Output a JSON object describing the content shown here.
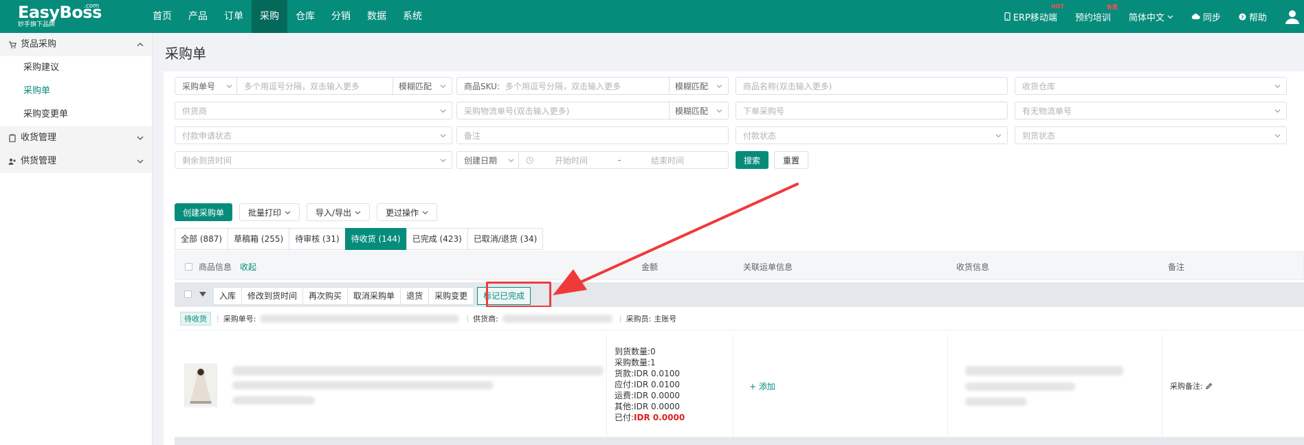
{
  "app": {
    "logo": "EasyBoss",
    "logo_com": ".com",
    "logo_sub": "妙手旗下品牌"
  },
  "nav": [
    "首页",
    "产品",
    "订单",
    "采购",
    "仓库",
    "分销",
    "数据",
    "系统"
  ],
  "topright": {
    "mobile": "ERP移动端",
    "mobile_badge": "HOT",
    "training": "预约培训",
    "training_badge": "免费",
    "language": "简体中文",
    "sync": "同步",
    "help": "帮助"
  },
  "sidebar": {
    "group1": "货品采购",
    "items": [
      "采购建议",
      "采购单",
      "采购变更单"
    ],
    "group2": "收货管理",
    "group3": "供货管理"
  },
  "page_title": "采购单",
  "filters": {
    "po_no_label": "采购单号",
    "po_no_ph": "多个用逗号分隔，双击输入更多",
    "match1": "模糊匹配",
    "sku_label": "商品SKU:",
    "sku_ph": "多个用逗号分隔，双击输入更多",
    "match2": "模糊匹配",
    "product_name_ph": "商品名称(双击输入更多)",
    "warehouse_ph": "收货仓库",
    "supplier_ph": "供货商",
    "logistics_ph": "采购物流单号(双击输入更多)",
    "match3": "模糊匹配",
    "order_no_ph": "下单采购号",
    "has_logistics_ph": "有无物流单号",
    "pay_apply_ph": "付款申请状态",
    "note_ph": "备注",
    "pay_status_ph": "付款状态",
    "arrival_status_ph": "到货状态",
    "remain_time_ph": "剩余到货时间",
    "date_type": "创建日期",
    "start_ph": "开始时间",
    "dash": "-",
    "end_ph": "结束时间",
    "search": "搜索",
    "reset": "重置"
  },
  "toolbar": {
    "create": "创建采购单",
    "print": "批量打印",
    "import_export": "导入/导出",
    "more": "更过操作"
  },
  "tabs": [
    {
      "label": "全部 (887)",
      "active": false
    },
    {
      "label": "草稿箱 (255)",
      "active": false
    },
    {
      "label": "待审核 (31)",
      "active": false
    },
    {
      "label": "待收货 (144)",
      "active": true
    },
    {
      "label": "已完成 (423)",
      "active": false
    },
    {
      "label": "已取消/退货 (34)",
      "active": false
    }
  ],
  "table": {
    "col_product": "商品信息",
    "collapse": "收起",
    "col_amount": "金额",
    "col_logistics": "关联运单信息",
    "col_receive": "收货信息",
    "col_note": "备注"
  },
  "actions": [
    "入库",
    "修改到货时间",
    "再次购买",
    "取消采购单",
    "退货",
    "采购变更",
    "标记已完成"
  ],
  "order": {
    "status": "待收货",
    "po_label": "采购单号:",
    "supplier_label": "供货商:",
    "buyer_label": "采购员:",
    "buyer": "主账号",
    "arrived_label": "到货数量:",
    "arrived": "0",
    "qty_label": "采购数量:",
    "qty": "1",
    "goods_label": "货款:",
    "goods": "IDR 0.0100",
    "payable_label": "应付:",
    "payable": "IDR 0.0100",
    "freight_label": "运费:",
    "freight": "IDR 0.0000",
    "other_label": "其他:",
    "other": "IDR 0.0000",
    "paid_label": "已付:",
    "paid": "IDR 0.0000",
    "add": "添加",
    "remark_label": "采购备注:"
  },
  "colors": {
    "brand": "#068c7b",
    "annotation": "#f03a3a"
  }
}
